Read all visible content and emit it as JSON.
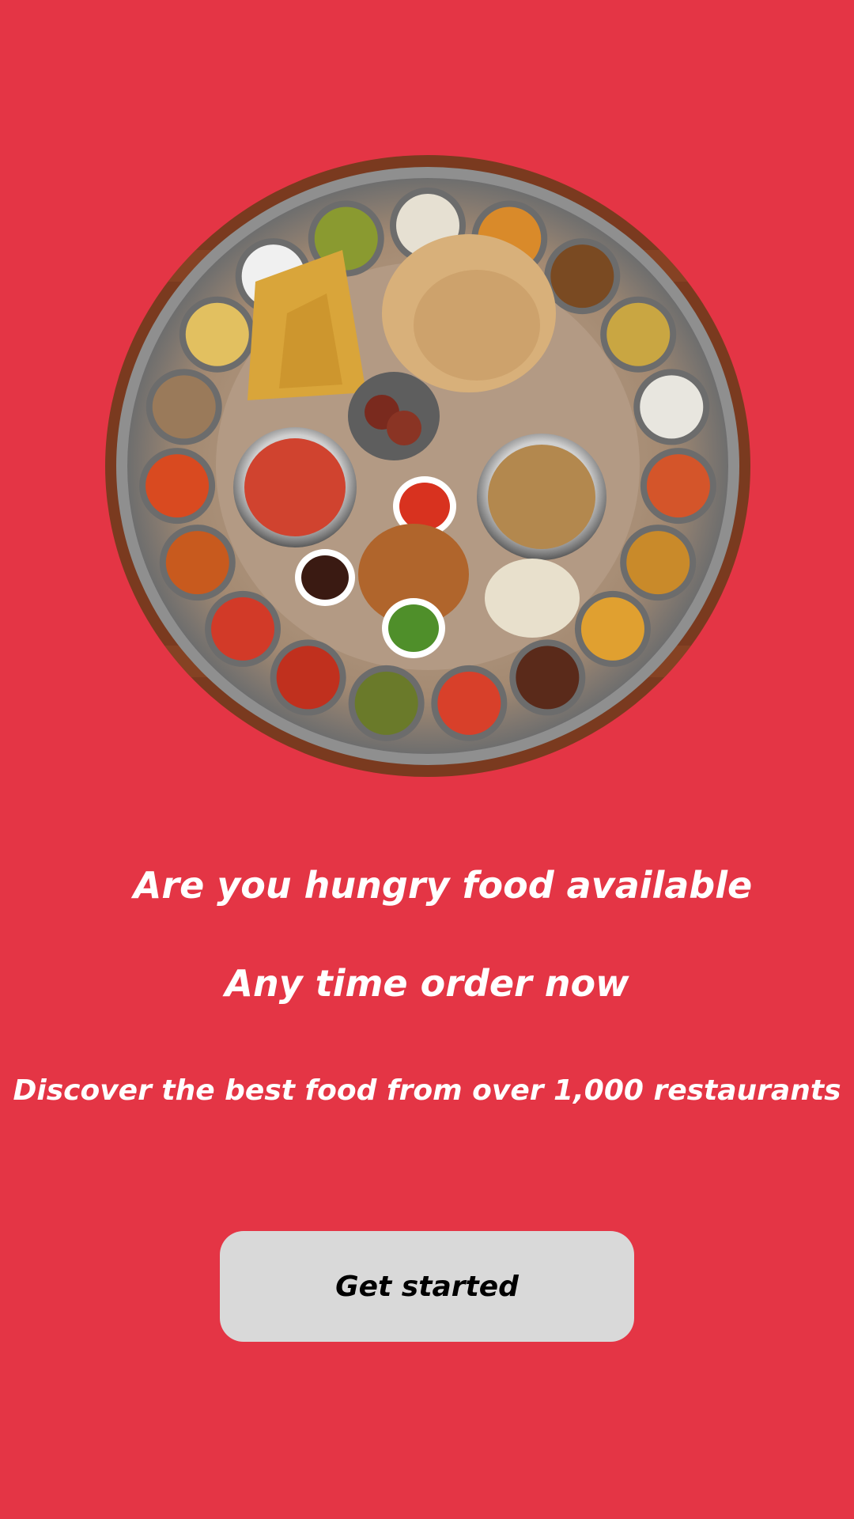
{
  "colors": {
    "background": "#e43545",
    "text": "#ffffff",
    "button_background": "#d9d9d9",
    "button_text": "#000000",
    "plate_rim": "#9a9a9a",
    "plate_surface": "#b8a08a",
    "wood_table": "#7a3a1f"
  },
  "hero": {
    "image_icon": "indian-thali-food-platter"
  },
  "intro": {
    "headline_line1": "Are you hungry food available",
    "headline_line2": "Any time order now",
    "subtitle": "Discover the best food from over 1,000 restaurants"
  },
  "cta": {
    "get_started_label": "Get started"
  }
}
